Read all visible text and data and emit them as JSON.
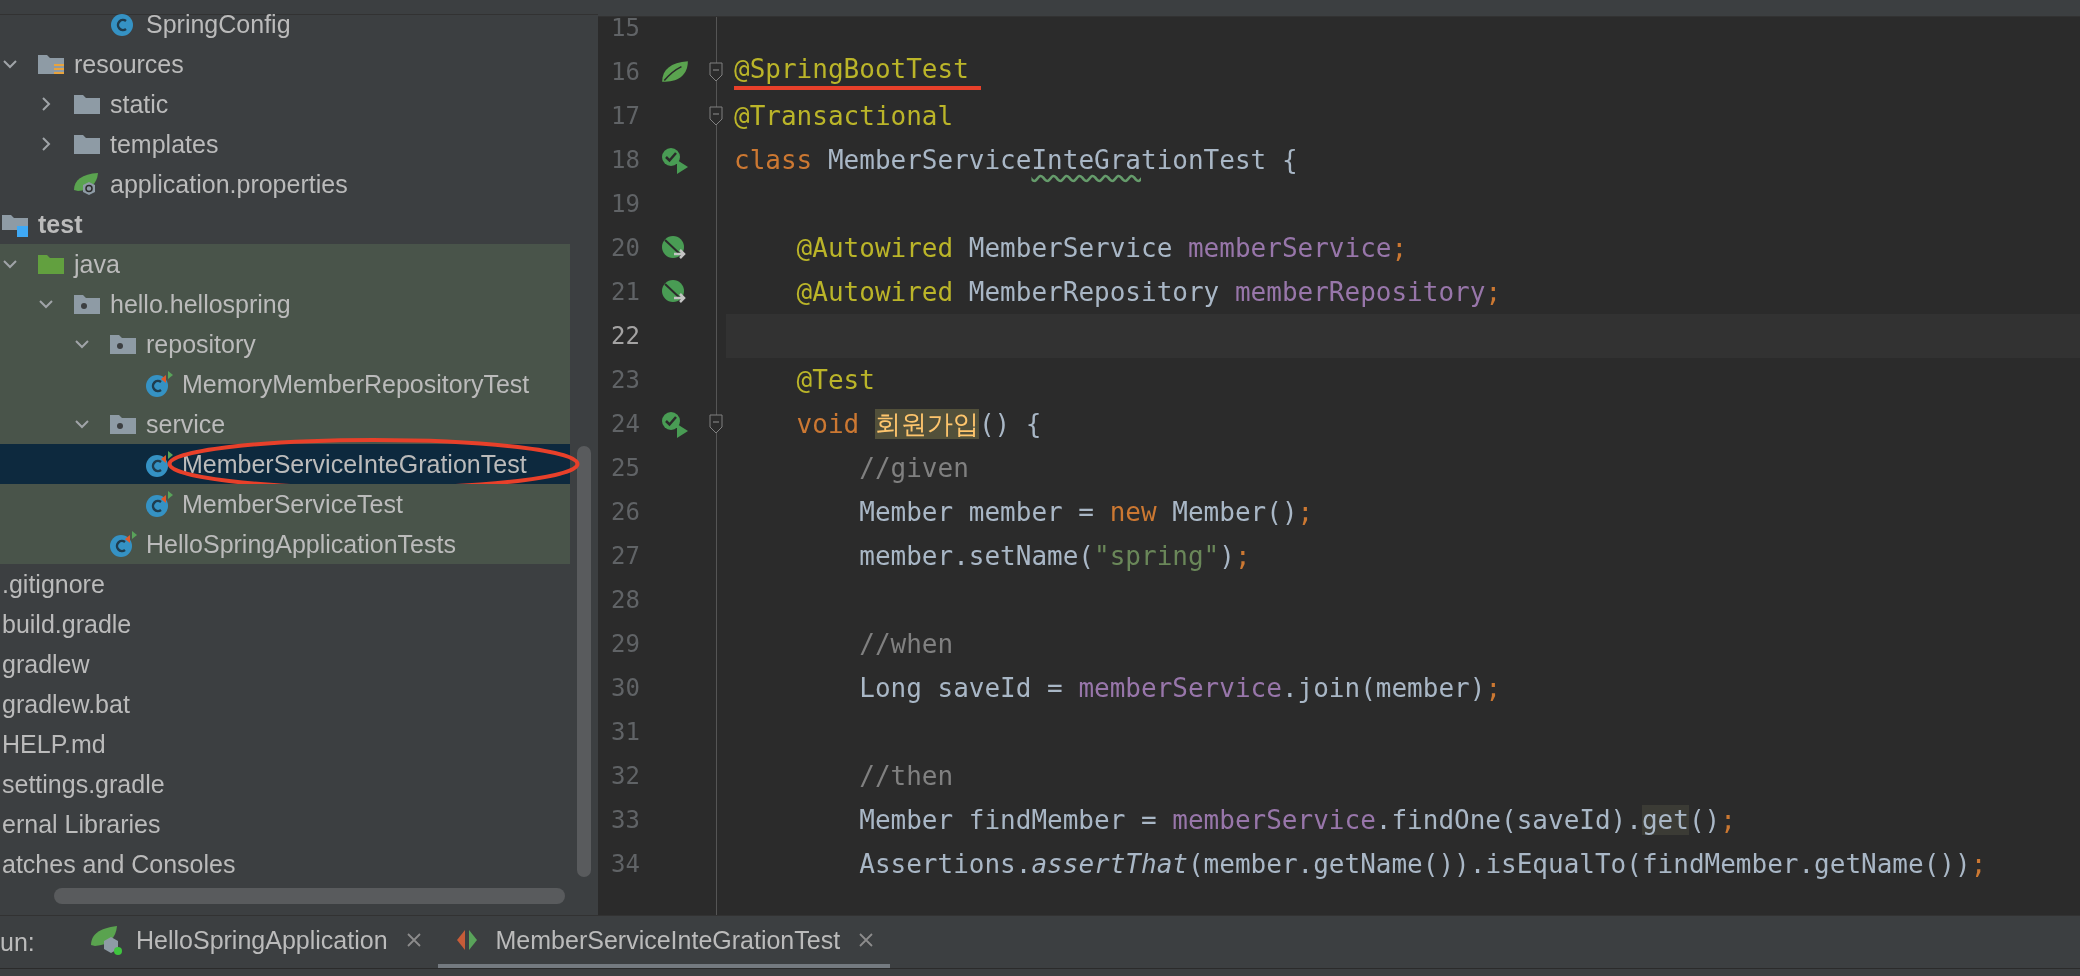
{
  "project_tree": {
    "items": [
      {
        "children": [
          {
            "children": [
              {
                "children": [
                  {
                    "children": [
                      {
                        "label": "SpringConfig",
                        "kind": "class",
                        "selected": false,
                        "test_sources": false
                      }
                    ]
                  }
                ]
              },
              {
                "label": "resources",
                "kind": "resources-folder",
                "expanded": true,
                "selected": false,
                "test_sources": false,
                "children": [
                  {
                    "label": "static",
                    "kind": "folder",
                    "expanded": false,
                    "selected": false,
                    "test_sources": false
                  },
                  {
                    "label": "templates",
                    "kind": "folder",
                    "expanded": false,
                    "selected": false,
                    "test_sources": false
                  },
                  {
                    "label": "application.properties",
                    "kind": "spring-properties",
                    "selected": false,
                    "test_sources": false
                  }
                ]
              }
            ]
          },
          {
            "label": "test",
            "kind": "test-root",
            "selected": false,
            "test_sources": false,
            "children": [
              {
                "label": "java",
                "kind": "test-source",
                "expanded": true,
                "selected": false,
                "test_sources": true,
                "children": [
                  {
                    "label": "hello.hellospring",
                    "kind": "package",
                    "expanded": true,
                    "selected": false,
                    "test_sources": true,
                    "children": [
                      {
                        "label": "repository",
                        "kind": "package",
                        "expanded": true,
                        "selected": false,
                        "test_sources": true,
                        "children": [
                          {
                            "label": "MemoryMemberRepositoryTest",
                            "kind": "test-class",
                            "selected": false,
                            "test_sources": true
                          }
                        ]
                      },
                      {
                        "label": "service",
                        "kind": "package",
                        "expanded": true,
                        "selected": false,
                        "test_sources": true,
                        "children": [
                          {
                            "label": "MemberServiceInteGrationTest",
                            "kind": "test-class",
                            "selected": true,
                            "circled": true,
                            "test_sources": true
                          },
                          {
                            "label": "MemberServiceTest",
                            "kind": "test-class",
                            "selected": false,
                            "test_sources": true
                          }
                        ]
                      },
                      {
                        "label": "HelloSpringApplicationTests",
                        "kind": "test-class",
                        "selected": false,
                        "test_sources": true
                      }
                    ]
                  }
                ]
              }
            ]
          }
        ]
      },
      {
        "label": ".gitignore",
        "selected": false,
        "test_sources": false
      },
      {
        "label": "build.gradle",
        "selected": false,
        "test_sources": false
      },
      {
        "label": "gradlew",
        "selected": false,
        "test_sources": false
      },
      {
        "label": "gradlew.bat",
        "selected": false,
        "test_sources": false
      },
      {
        "label": "HELP.md",
        "selected": false,
        "test_sources": false
      },
      {
        "label": "settings.gradle",
        "selected": false,
        "test_sources": false
      },
      {
        "label": "ernal Libraries",
        "selected": false,
        "test_sources": false
      },
      {
        "label": "atches and Consoles",
        "selected": false,
        "test_sources": false
      }
    ]
  },
  "editor": {
    "lines": [
      {
        "number": "15",
        "current": false
      },
      {
        "number": "16",
        "current": false,
        "gutter": {
          "kind": "spring-leaf"
        },
        "fold": true,
        "tokens": [
          {
            "text": "@SpringBootTest",
            "kind": "annotation",
            "underlined": true
          }
        ]
      },
      {
        "number": "17",
        "current": false,
        "fold": true,
        "tokens": [
          {
            "text": "@Transactional",
            "kind": "annotation"
          }
        ]
      },
      {
        "number": "18",
        "current": false,
        "gutter": {
          "kind": "run-test"
        },
        "tokens": [
          {
            "text": "class ",
            "kind": "keyword"
          },
          {
            "text": "MemberService",
            "kind": "plain"
          },
          {
            "text": "InteGra",
            "kind": "typo"
          },
          {
            "text": "tionTest {",
            "kind": "plain"
          }
        ]
      },
      {
        "number": "19",
        "current": false
      },
      {
        "number": "20",
        "current": false,
        "gutter": {
          "kind": "bean"
        },
        "tokens": [
          {
            "text": "    @Autowired",
            "kind": "annotation"
          },
          {
            "text": " MemberService ",
            "kind": "plain"
          },
          {
            "text": "memberService",
            "kind": "field"
          },
          {
            "text": ";",
            "kind": "keyword"
          }
        ]
      },
      {
        "number": "21",
        "current": false,
        "gutter": {
          "kind": "bean"
        },
        "tokens": [
          {
            "text": "    @Autowired",
            "kind": "annotation"
          },
          {
            "text": " MemberRepository ",
            "kind": "plain"
          },
          {
            "text": "memberRepository",
            "kind": "field"
          },
          {
            "text": ";",
            "kind": "keyword"
          }
        ]
      },
      {
        "number": "22",
        "current": true
      },
      {
        "number": "23",
        "current": false,
        "tokens": [
          {
            "text": "    @Test",
            "kind": "annotation"
          }
        ]
      },
      {
        "number": "24",
        "current": false,
        "gutter": {
          "kind": "run-test"
        },
        "fold": true,
        "tokens": [
          {
            "text": "    void ",
            "kind": "keyword"
          },
          {
            "text": "회원가입",
            "kind": "declaration"
          },
          {
            "text": "() {",
            "kind": "plain"
          }
        ]
      },
      {
        "number": "25",
        "current": false,
        "tokens": [
          {
            "text": "        //given",
            "kind": "comment"
          }
        ]
      },
      {
        "number": "26",
        "current": false,
        "tokens": [
          {
            "text": "        Member member = ",
            "kind": "plain"
          },
          {
            "text": "new",
            "kind": "keyword"
          },
          {
            "text": " Member()",
            "kind": "plain"
          },
          {
            "text": ";",
            "kind": "keyword"
          }
        ]
      },
      {
        "number": "27",
        "current": false,
        "tokens": [
          {
            "text": "        member.setName(",
            "kind": "plain"
          },
          {
            "text": "\"spring\"",
            "kind": "string"
          },
          {
            "text": ")",
            "kind": "plain"
          },
          {
            "text": ";",
            "kind": "keyword"
          }
        ]
      },
      {
        "number": "28",
        "current": false
      },
      {
        "number": "29",
        "current": false,
        "tokens": [
          {
            "text": "        //when",
            "kind": "comment"
          }
        ]
      },
      {
        "number": "30",
        "current": false,
        "tokens": [
          {
            "text": "        Long saveId = ",
            "kind": "plain"
          },
          {
            "text": "memberService",
            "kind": "field"
          },
          {
            "text": ".join(member)",
            "kind": "plain"
          },
          {
            "text": ";",
            "kind": "keyword"
          }
        ]
      },
      {
        "number": "31",
        "current": false
      },
      {
        "number": "32",
        "current": false,
        "tokens": [
          {
            "text": "        //then",
            "kind": "comment"
          }
        ]
      },
      {
        "number": "33",
        "current": false,
        "tokens": [
          {
            "text": "        Member findMember = ",
            "kind": "plain"
          },
          {
            "text": "memberService",
            "kind": "field"
          },
          {
            "text": ".findOne(saveId).",
            "kind": "plain"
          },
          {
            "text": "get",
            "kind": "usage"
          },
          {
            "text": "()",
            "kind": "plain"
          },
          {
            "text": ";",
            "kind": "keyword"
          }
        ]
      },
      {
        "number": "34",
        "current": false,
        "tokens": [
          {
            "text": "        Assertions.",
            "kind": "plain"
          },
          {
            "text": "assertThat",
            "kind": "static"
          },
          {
            "text": "(member.getName()).isEqualTo(findMember.getName())",
            "kind": "plain"
          },
          {
            "text": ";",
            "kind": "keyword"
          }
        ]
      }
    ]
  },
  "run_bar": {
    "label": "un:",
    "tabs": [
      {
        "label": "HelloSpringApplication",
        "kind": "spring-app",
        "selected": false
      },
      {
        "label": "MemberServiceInteGrationTest",
        "kind": "test-run",
        "selected": true
      }
    ]
  }
}
